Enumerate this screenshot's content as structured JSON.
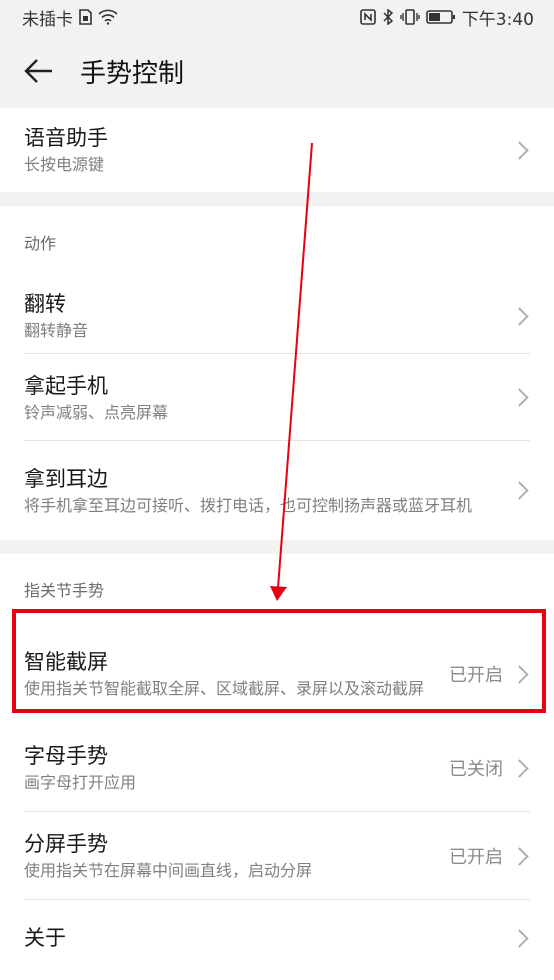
{
  "status_bar": {
    "carrier": "未插卡",
    "time": "下午3:40",
    "icons": [
      "sim-icon",
      "wifi-icon",
      "nfc-icon",
      "bluetooth-icon",
      "vibrate-icon",
      "battery-icon"
    ]
  },
  "header": {
    "title": "手势控制",
    "back_icon": "arrow-left-icon"
  },
  "voice": {
    "title": "语音助手",
    "subtitle": "长按电源键"
  },
  "actions": {
    "section_title": "动作",
    "items": [
      {
        "title": "翻转",
        "subtitle": "翻转静音"
      },
      {
        "title": "拿起手机",
        "subtitle": "铃声减弱、点亮屏幕"
      },
      {
        "title": "拿到耳边",
        "subtitle": "将手机拿至耳边可接听、拨打电话，也可控制扬声器或蓝牙耳机"
      }
    ]
  },
  "knuckle": {
    "section_title": "指关节手势",
    "items": [
      {
        "title": "智能截屏",
        "subtitle": "使用指关节智能截取全屏、区域截屏、录屏以及滚动截屏",
        "status": "已开启"
      },
      {
        "title": "字母手势",
        "subtitle": "画字母打开应用",
        "status": "已关闭"
      },
      {
        "title": "分屏手势",
        "subtitle": "使用指关节在屏幕中间画直线，启动分屏",
        "status": "已开启"
      },
      {
        "title": "关于"
      }
    ]
  },
  "annotation": {
    "color": "#e60012"
  }
}
